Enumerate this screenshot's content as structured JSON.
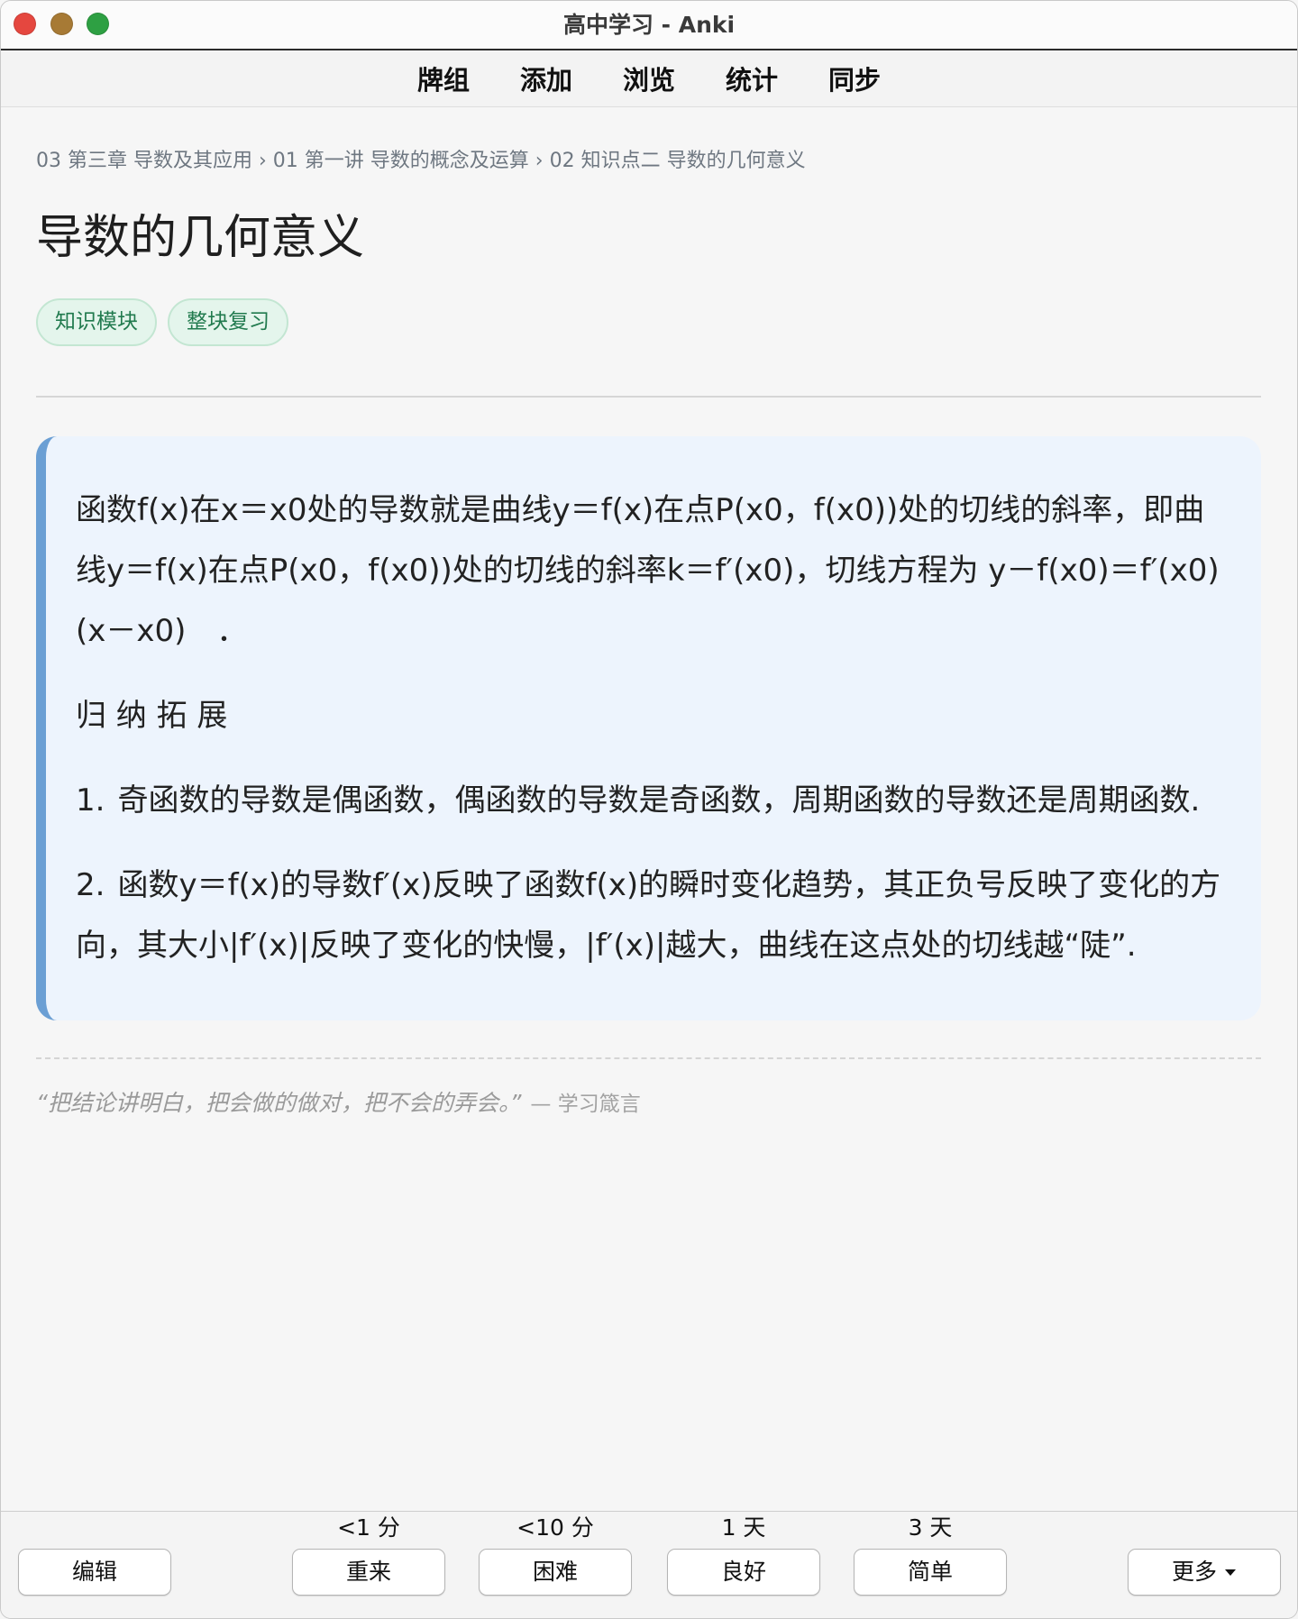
{
  "window": {
    "title": "高中学习 - Anki",
    "controls": {
      "close": "close-button",
      "minimize": "minimize-button",
      "zoom": "zoom-button"
    }
  },
  "toolbar": {
    "items": [
      "牌组",
      "添加",
      "浏览",
      "统计",
      "同步"
    ]
  },
  "breadcrumb": {
    "segments": [
      "03 第三章 导数及其应用",
      "01 第一讲 导数的概念及运算",
      "02 知识点二 导数的几何意义"
    ],
    "separator": "›"
  },
  "card": {
    "title": "导数的几何意义",
    "tags": [
      "知识模块",
      "整块复习"
    ],
    "definition": "函数f(x)在x＝x0处的导数就是曲线y＝f(x)在点P(x0，f(x0))处的切线的斜率，即曲线y＝f(x)在点P(x0，f(x0))处的切线的斜率k＝f′(x0)，切线方程为 y－f(x0)＝f′(x0)(x－x0)　．",
    "section_heading": "归 纳 拓 展",
    "list": [
      {
        "marker": "1.",
        "text": "奇函数的导数是偶函数，偶函数的导数是奇函数，周期函数的导数还是周期函数."
      },
      {
        "marker": "2.",
        "text": "函数y＝f(x)的导数f′(x)反映了函数f(x)的瞬时变化趋势，其正负号反映了变化的方向，其大小|f′(x)|反映了变化的快慢，|f′(x)|越大，曲线在这点处的切线越“陡”."
      }
    ]
  },
  "quote": {
    "text": "“把结论讲明白，把会做的做对，把不会的弄会。”",
    "attribution": "— 学习箴言"
  },
  "answer_bar": {
    "edit_label": "编辑",
    "answers": [
      {
        "interval": "<1 分",
        "label": "重来"
      },
      {
        "interval": "<10 分",
        "label": "困难"
      },
      {
        "interval": "1 天",
        "label": "良好"
      },
      {
        "interval": "3 天",
        "label": "简单"
      }
    ],
    "more_label": "更多",
    "more_icon": "caret-down-icon"
  },
  "colors": {
    "close": "#e5473f",
    "minimize": "#a77a35",
    "zoom": "#2ea043",
    "card_background": "#edf4fd",
    "card_accent": "#6b9fd4",
    "tag_background": "#e4f5ec",
    "tag_text": "#217a4e"
  }
}
